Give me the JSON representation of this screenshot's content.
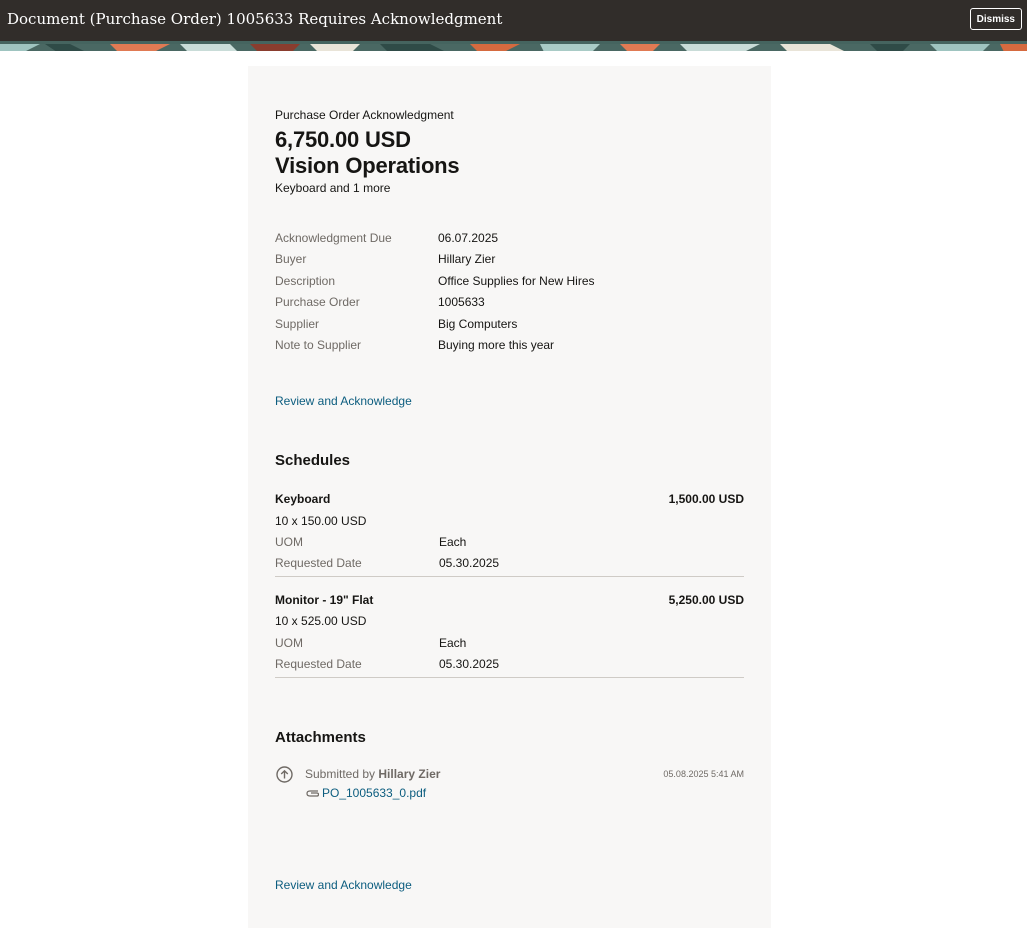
{
  "header": {
    "title": "Document (Purchase Order) 1005633 Requires Acknowledgment",
    "dismiss_label": "Dismiss"
  },
  "summary": {
    "type_label": "Purchase Order Acknowledgment",
    "amount": "6,750.00 USD",
    "organization": "Vision Operations",
    "items_summary": "Keyboard and 1 more"
  },
  "details": [
    {
      "label": "Acknowledgment Due",
      "value": "06.07.2025"
    },
    {
      "label": "Buyer",
      "value": "Hillary Zier"
    },
    {
      "label": "Description",
      "value": "Office Supplies for New Hires"
    },
    {
      "label": "Purchase Order",
      "value": "1005633"
    },
    {
      "label": "Supplier",
      "value": "Big Computers"
    },
    {
      "label": "Note to Supplier",
      "value": "Buying more this year"
    }
  ],
  "actions": {
    "review_link_top": "Review and Acknowledge",
    "review_link_bottom": "Review and Acknowledge"
  },
  "schedules": {
    "heading": "Schedules",
    "items": [
      {
        "name": "Keyboard",
        "total": "1,500.00 USD",
        "qty_price": "10 x 150.00 USD",
        "uom_label": "UOM",
        "uom_value": "Each",
        "date_label": "Requested Date",
        "date_value": "05.30.2025"
      },
      {
        "name": "Monitor - 19\" Flat",
        "total": "5,250.00 USD",
        "qty_price": "10 x 525.00 USD",
        "uom_label": "UOM",
        "uom_value": "Each",
        "date_label": "Requested Date",
        "date_value": "05.30.2025"
      }
    ]
  },
  "attachments": {
    "heading": "Attachments",
    "submitted_prefix": "Submitted by",
    "submitted_by": "Hillary Zier",
    "timestamp": "05.08.2025 5:41 AM",
    "file_name": "PO_1005633_0.pdf",
    "icons": [
      "upload-arrow-icon",
      "paperclip-icon"
    ]
  },
  "colors": {
    "header_bg": "#312d2a",
    "card_bg": "#f8f7f6",
    "link": "#0c5d7f",
    "label": "#6f6a65"
  }
}
